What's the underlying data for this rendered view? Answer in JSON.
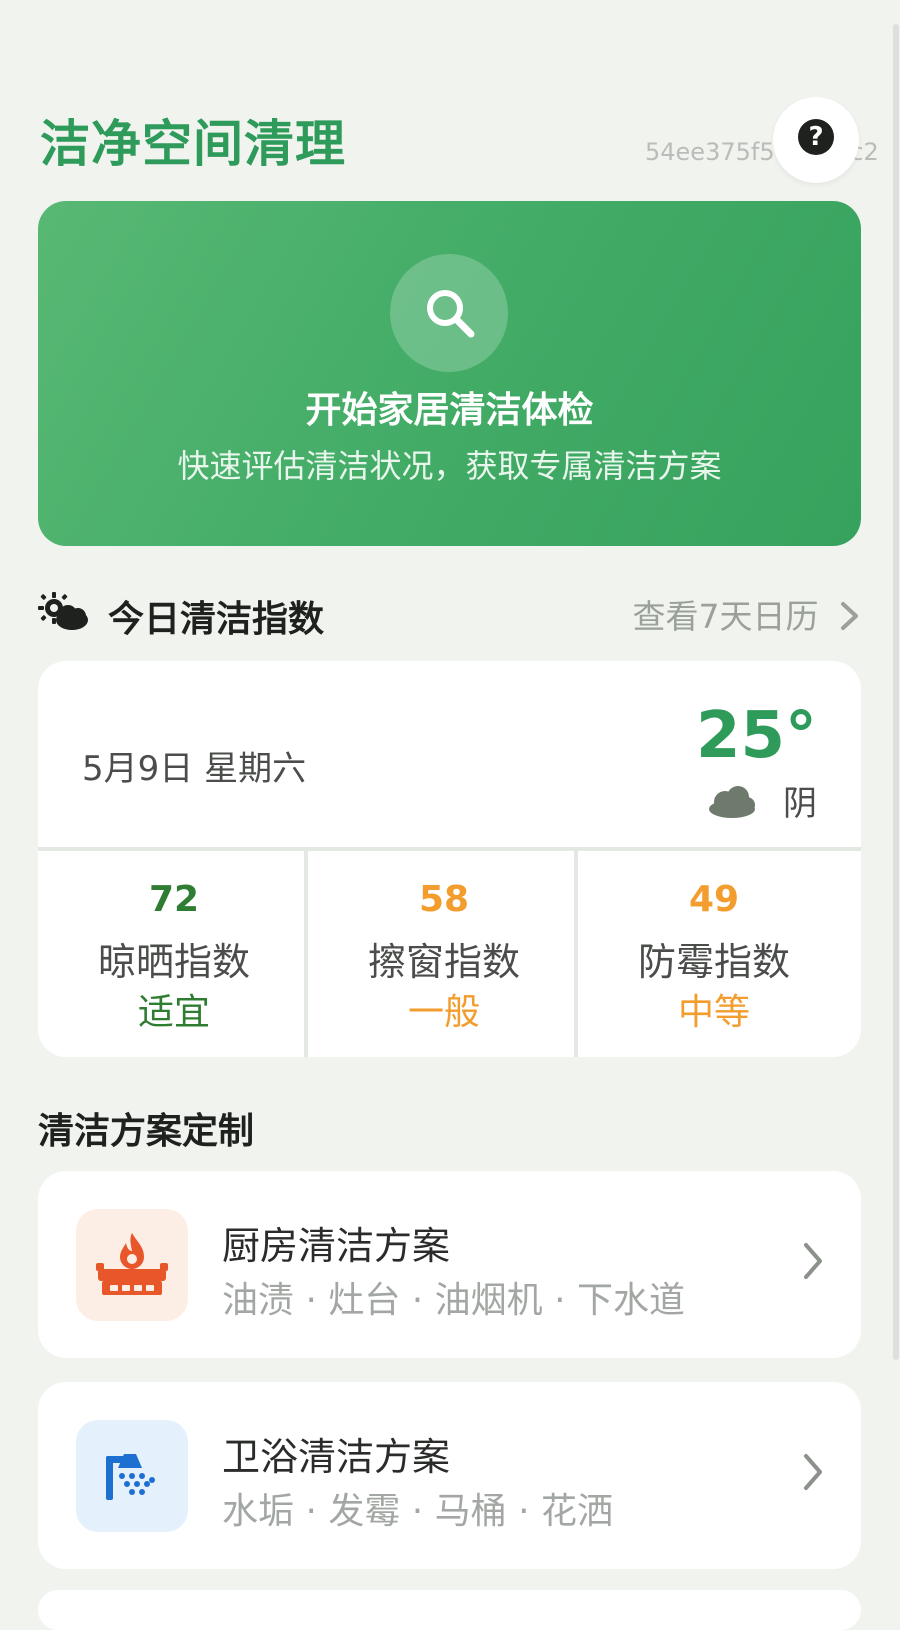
{
  "header": {
    "title": "洁净空间清理",
    "device_id": "54ee375f5da3b3c2",
    "help_icon": "question-mark-icon",
    "help_label": "?"
  },
  "hero": {
    "title": "开始家居清洁体检",
    "subtitle": "快速评估清洁状况，获取专属清洁方案",
    "icon": "search-icon",
    "bg_color": "#44ad68"
  },
  "daily_index": {
    "section_title": "今日清洁指数",
    "section_icon": "sun-cloud-icon",
    "calendar_link": "查看7天日历",
    "date": "5月9日 星期六",
    "temperature": "25°",
    "weather": "阴",
    "weather_icon": "cloud-icon",
    "metrics": [
      {
        "value": "72",
        "name": "晾晒指数",
        "level": "适宜",
        "color": "#2e7d32"
      },
      {
        "value": "58",
        "name": "擦窗指数",
        "level": "一般",
        "color": "#f29d2e"
      },
      {
        "value": "49",
        "name": "防霉指数",
        "level": "中等",
        "color": "#f29d2e"
      }
    ]
  },
  "plans": {
    "section_title": "清洁方案定制",
    "items": [
      {
        "title": "厨房清洁方案",
        "tags": "油渍 · 灶台 · 油烟机 · 下水道",
        "icon": "stove-fire-icon",
        "icon_bg": "#fdeee5",
        "icon_color": "#e8572a"
      },
      {
        "title": "卫浴清洁方案",
        "tags": "水垢 · 发霉 · 马桶 · 花洒",
        "icon": "shower-icon",
        "icon_bg": "#e4f0fc",
        "icon_color": "#1d6fd1"
      }
    ]
  },
  "theme": {
    "accent": "#2f9b5b",
    "background": "#f1f3ef"
  }
}
